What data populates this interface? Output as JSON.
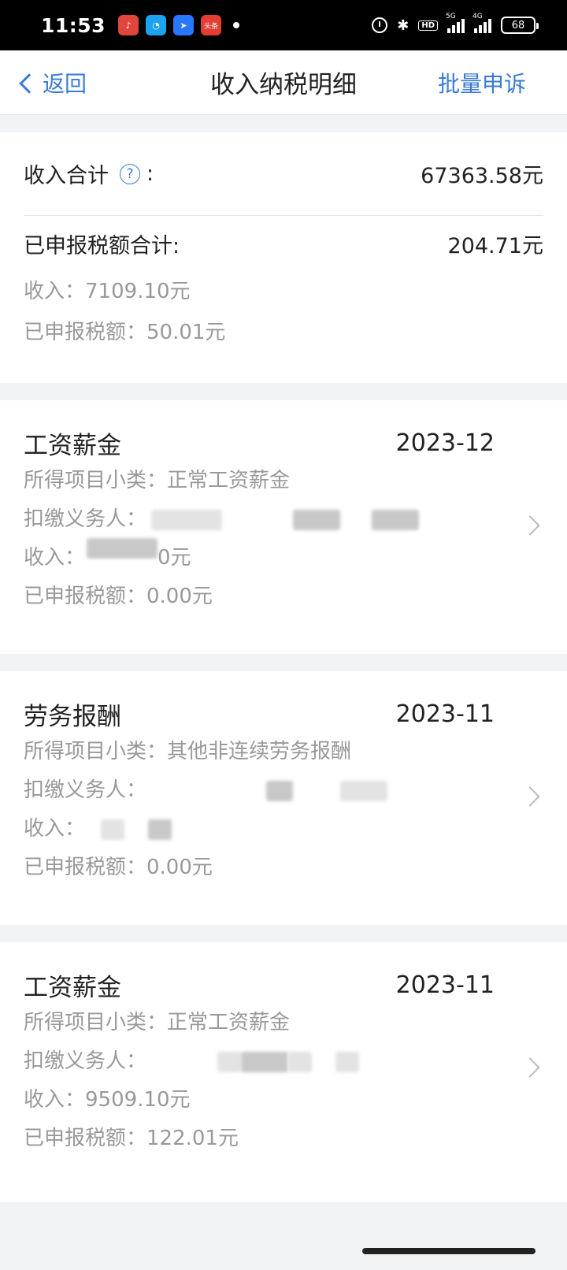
{
  "status_bar": {
    "time": "11:53",
    "apps": [
      "music-icon",
      "qq-browser-icon",
      "baidu-icon",
      "toutiao-icon"
    ],
    "toutiao_label": "头条",
    "signal1": "5G",
    "signal2": "4G",
    "hd_label": "HD",
    "battery": "68"
  },
  "navbar": {
    "back_label": "返回",
    "title": "收入纳税明细",
    "action_label": "批量申诉"
  },
  "summary": {
    "income_total_label": "收入合计",
    "income_total_value": "67363.58元",
    "tax_total_label": "已申报税额合计:",
    "tax_total_value": "204.71元",
    "income_line": "收入：7109.10元",
    "tax_line": "已申报税额：50.01元"
  },
  "records": [
    {
      "type": "工资薪金",
      "date": "2023-12",
      "subcategory": "所得项目小类：正常工资薪金",
      "withholder_label": "扣缴义务人：",
      "income_label": "收入：",
      "income_suffix": "0元",
      "tax": "已申报税额：0.00元"
    },
    {
      "type": "劳务报酬",
      "date": "2023-11",
      "subcategory": "所得项目小类：其他非连续劳务报酬",
      "withholder_label": "扣缴义务人：",
      "income_label": "收入：",
      "tax": "已申报税额：0.00元"
    },
    {
      "type": "工资薪金",
      "date": "2023-11",
      "subcategory": "所得项目小类：正常工资薪金",
      "withholder_label": "扣缴义务人：",
      "income": "收入：9509.10元",
      "tax": "已申报税额：122.01元"
    }
  ],
  "colors": {
    "accent": "#3a7bd5",
    "background": "#f2f3f5",
    "secondary_text": "#999999"
  }
}
